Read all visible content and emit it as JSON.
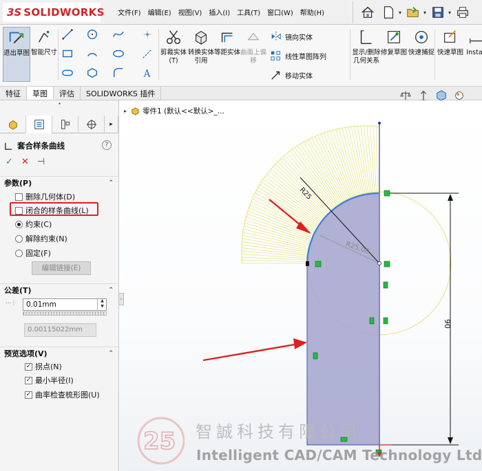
{
  "app": {
    "brand_prefix": "3S",
    "brand": "SOLIDWORKS"
  },
  "menu": [
    "文件(F)",
    "编辑(E)",
    "视图(V)",
    "插入(I)",
    "工具(T)",
    "窗口(W)",
    "帮助(H)"
  ],
  "ribbon": {
    "exit_sketch": "退出草图",
    "smart_dim": "智能尺寸",
    "trim": "剪裁实体(T)",
    "convert": "转换实体引用",
    "offset": "等距实体",
    "offset_surface": "曲面上偏移",
    "mirror": "镜向实体",
    "linear_pattern": "线性草图阵列",
    "move": "移动实体",
    "show_relations": "显示/删除几何关系",
    "repair": "修复草图",
    "quick_snap": "快速捕捉",
    "rapid_sketch": "快速草图",
    "instant": "Instan"
  },
  "tabs": [
    "特征",
    "草图",
    "评估",
    "SOLIDWORKS 插件"
  ],
  "active_tab": "草图",
  "tree": {
    "root": "零件1 (默认<<默认>_..."
  },
  "property_manager": {
    "title": "套合样条曲线",
    "help": "?",
    "ok": "✓",
    "cancel": "✕",
    "pin": "⊣",
    "params": {
      "heading": "参数(P)",
      "delete_geometry": "删除几何体(D)",
      "closed_spline": "闭合的样条曲线(L)",
      "constrained": "约束(C)",
      "unconstrained": "解除约束(N)",
      "fixed": "固定(F)",
      "edit_link": "编辑链接(E)"
    },
    "tolerance": {
      "heading": "公差(T)",
      "value": "0.01mm",
      "computed": "0.00115022mm"
    },
    "preview": {
      "heading": "预览选项(V)",
      "inflection": "拐点(N)",
      "min_radius": "最小半径(I)",
      "curvature_comb": "曲率检查梳形图(U)"
    }
  },
  "sketch": {
    "radius_label": "R25",
    "radius_ghost": "R25.00",
    "height_label": "90"
  },
  "watermark": {
    "number": "25",
    "company_cn": "智誠科技有限公司",
    "company_en": "Intelligent CAD/CAM Technology Ltd."
  },
  "colors": {
    "brand_red": "#d2232a",
    "fill": "#a7a9cf",
    "spline": "#3a7fe0",
    "comb": "#e6e37a",
    "annotation_red": "#e02020"
  }
}
